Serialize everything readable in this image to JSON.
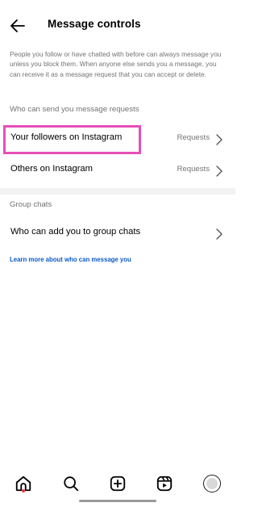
{
  "header": {
    "title": "Message controls",
    "back_icon": "arrow-left-icon"
  },
  "intro": {
    "text": "People you follow or have chatted with before can always message you unless you block them. When anyone else sends you a message, you can receive it as a message request that you can accept or delete."
  },
  "requests_section": {
    "label": "Who can send you message requests",
    "items": [
      {
        "label": "Your followers on Instagram",
        "value": "Requests"
      },
      {
        "label": "Others on Instagram",
        "value": "Requests"
      }
    ]
  },
  "group_section": {
    "label": "Group chats",
    "items": [
      {
        "label": "Who can add you to group chats"
      }
    ]
  },
  "learn_more": {
    "text": "Learn more about who can message you"
  },
  "colors": {
    "highlight": "#e64fb7",
    "link": "#0a5bc6",
    "secondary_text": "#737373",
    "notification_dot": "#ff3040"
  },
  "bottom_nav": {
    "items": [
      {
        "icon": "home-icon",
        "active": true,
        "has_dot": true
      },
      {
        "icon": "search-icon"
      },
      {
        "icon": "create-plus-icon"
      },
      {
        "icon": "reels-icon"
      },
      {
        "icon": "profile-avatar-icon"
      }
    ]
  }
}
